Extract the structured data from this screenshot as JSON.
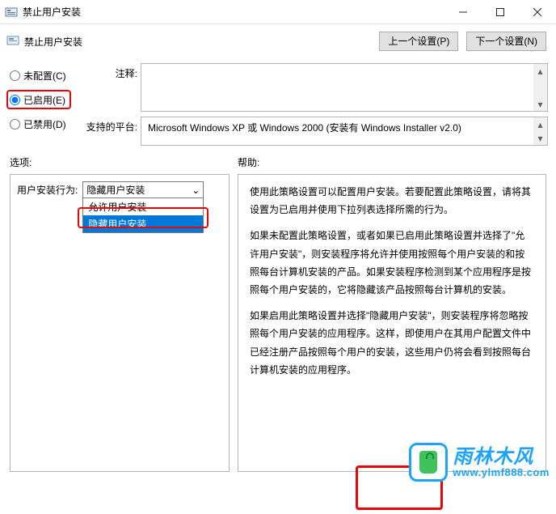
{
  "title": "禁止用户安装",
  "toolbar": {
    "title_repeat": "禁止用户安装",
    "prev_btn": "上一个设置(P)",
    "next_btn": "下一个设置(N)"
  },
  "config": {
    "not_configured": "未配置(C)",
    "enabled": "已启用(E)",
    "disabled": "已禁用(D)",
    "selected": "enabled"
  },
  "fields": {
    "comment_label": "注释:",
    "comment_value": "",
    "platform_label": "支持的平台:",
    "platform_value": "Microsoft Windows XP 或 Windows 2000 (安装有 Windows Installer v2.0)"
  },
  "sections": {
    "options": "选项:",
    "help": "帮助:"
  },
  "options": {
    "behavior_label": "用户安装行为:",
    "behavior_selected": "隐藏用户安装",
    "behavior_items": [
      "允许用户安装",
      "隐藏用户安装"
    ],
    "behavior_selected_index": 1
  },
  "help": {
    "p1": "使用此策略设置可以配置用户安装。若要配置此策略设置，请将其设置为已启用并使用下拉列表选择所需的行为。",
    "p2": "如果未配置此策略设置，或者如果已启用此策略设置并选择了\"允许用户安装\"，则安装程序将允许并使用按照每个用户安装的和按照每台计算机安装的产品。如果安装程序检测到某个应用程序是按照每个用户安装的，它将隐藏该产品按照每台计算机的安装。",
    "p3": "如果启用此策略设置并选择\"隐藏用户安装\"，则安装程序将忽略按照每个用户安装的应用程序。这样，即使用户在其用户配置文件中已经注册产品按照每个用户的安装，这些用户仍将会看到按照每台计算机安装的应用程序。"
  },
  "watermark": {
    "brand_cn": "雨林木风",
    "brand_url": "www.ylmf888.com"
  },
  "icons": {
    "app": "gpedit-icon",
    "min": "window-minimize-icon",
    "max": "window-maximize-icon",
    "close": "window-close-icon",
    "scroll_up": "▴",
    "scroll_dn": "▾",
    "chev": "⌄"
  }
}
